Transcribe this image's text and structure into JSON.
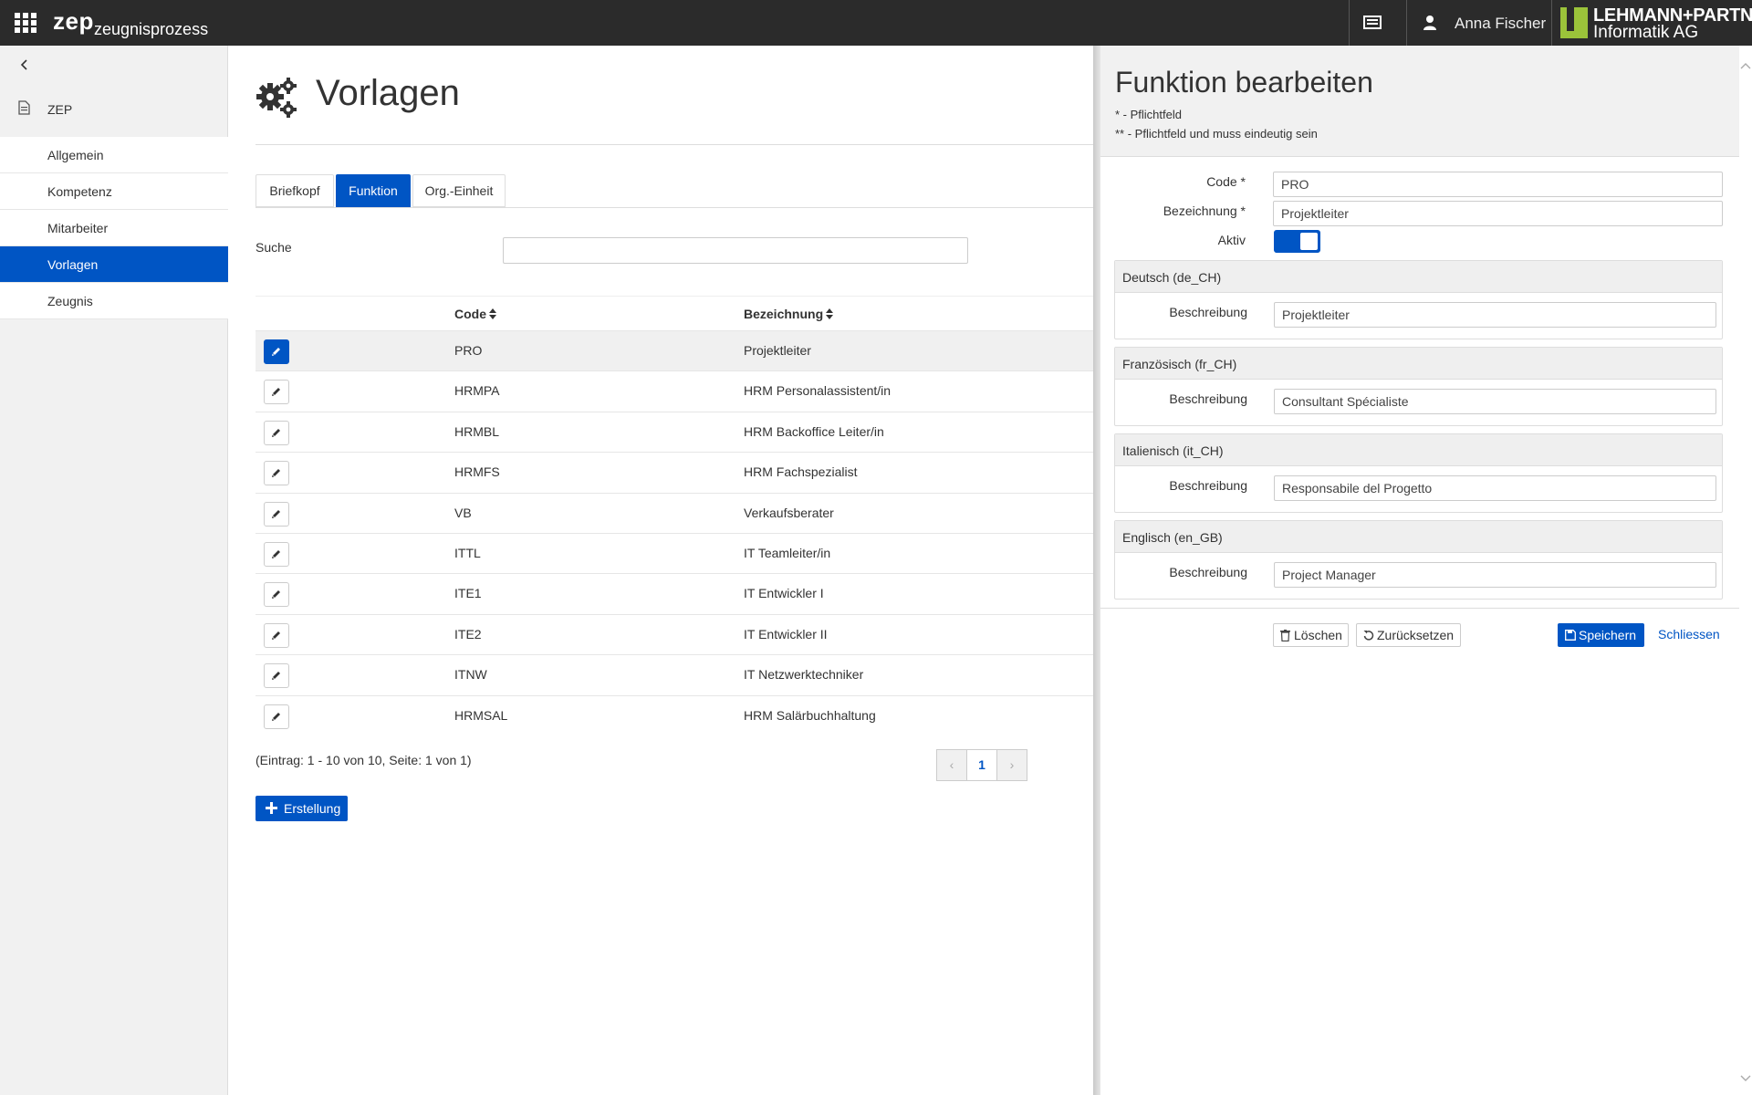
{
  "app": {
    "brand": "zep",
    "brand_sub": "zeugnisprozess",
    "user_name": "Anna Fischer",
    "logo_line1": "LEHMANN+PARTNER",
    "logo_line2": "Informatik AG"
  },
  "colors": {
    "accent": "#0055c4",
    "topbar": "#2b2b2b",
    "logo_green": "#9bc33a"
  },
  "sidebar": {
    "root": "ZEP",
    "items": [
      {
        "label": "Allgemein"
      },
      {
        "label": "Kompetenz"
      },
      {
        "label": "Mitarbeiter"
      },
      {
        "label": "Vorlagen",
        "active": true
      },
      {
        "label": "Zeugnis"
      }
    ]
  },
  "main": {
    "title": "Vorlagen",
    "tabs": [
      {
        "label": "Briefkopf"
      },
      {
        "label": "Funktion",
        "active": true
      },
      {
        "label": "Org.-Einheit"
      }
    ],
    "search_label": "Suche",
    "search_value": "",
    "table": {
      "columns": [
        "Code",
        "Bezeichnung"
      ],
      "rows": [
        {
          "code": "PRO",
          "name": "Projektleiter"
        },
        {
          "code": "HRMPA",
          "name": "HRM Personalassistent/in"
        },
        {
          "code": "HRMBL",
          "name": "HRM Backoffice Leiter/in"
        },
        {
          "code": "HRMFS",
          "name": "HRM Fachspezialist"
        },
        {
          "code": "VB",
          "name": "Verkaufsberater"
        },
        {
          "code": "ITTL",
          "name": "IT Teamleiter/in"
        },
        {
          "code": "ITE1",
          "name": "IT Entwickler I"
        },
        {
          "code": "ITE2",
          "name": "IT Entwickler II"
        },
        {
          "code": "ITNW",
          "name": "IT Netzwerktechniker"
        },
        {
          "code": "HRMSAL",
          "name": "HRM Salärbuchhaltung"
        }
      ]
    },
    "entries_info": "(Eintrag: 1 - 10 von 10, Seite: 1 von 1)",
    "pager": {
      "prev": "‹",
      "current": "1",
      "next": "›"
    },
    "create_label": "Erstellung"
  },
  "panel": {
    "title": "Funktion bearbeiten",
    "note1": "* - Pflichtfeld",
    "note2": "** - Pflichtfeld und muss eindeutig sein",
    "code_label": "Code *",
    "code_value": "PRO",
    "name_label": "Bezeichnung *",
    "name_value": "Projektleiter",
    "active_label": "Aktiv",
    "active": true,
    "desc_label": "Beschreibung",
    "languages": [
      {
        "title": "Deutsch (de_CH)",
        "value": "Projektleiter"
      },
      {
        "title": "Französisch (fr_CH)",
        "value": "Consultant Spécialiste"
      },
      {
        "title": "Italienisch (it_CH)",
        "value": "Responsabile del Progetto"
      },
      {
        "title": "Englisch (en_GB)",
        "value": "Project Manager"
      }
    ],
    "delete_label": "Löschen",
    "reset_label": "Zurücksetzen",
    "save_label": "Speichern",
    "close_label": "Schliessen"
  }
}
